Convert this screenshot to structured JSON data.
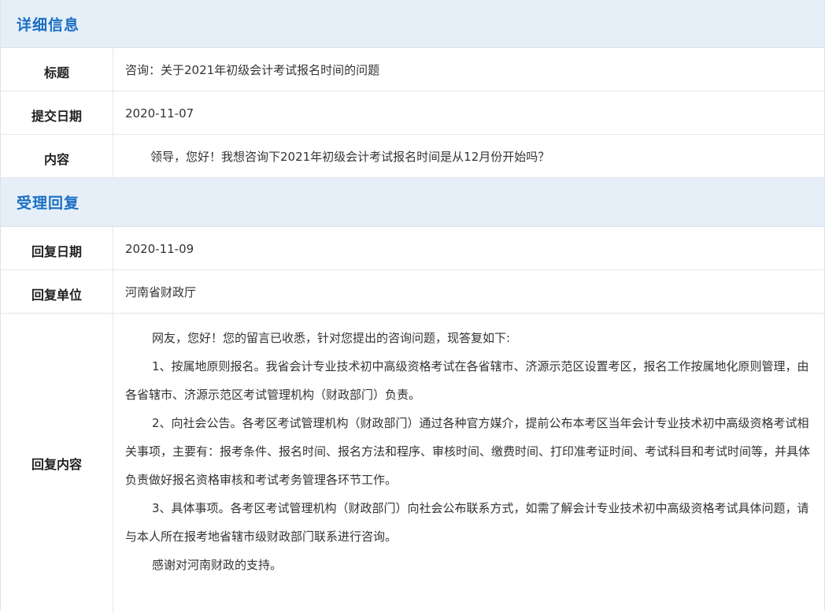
{
  "detail": {
    "header": "详细信息",
    "title_label": "标题",
    "title_value": "咨询：关于2021年初级会计考试报名时间的问题",
    "date_label": "提交日期",
    "date_value": "2020-11-07",
    "content_label": "内容",
    "content_value": "领导，您好！我想咨询下2021年初级会计考试报名时间是从12月份开始吗？"
  },
  "reply": {
    "header": "受理回复",
    "date_label": "回复日期",
    "date_value": "2020-11-09",
    "unit_label": "回复单位",
    "unit_value": "河南省财政厅",
    "content_label": "回复内容",
    "paragraphs": [
      "网友，您好！您的留言已收悉，针对您提出的咨询问题，现答复如下:",
      "1、按属地原则报名。我省会计专业技术初中高级资格考试在各省辖市、济源示范区设置考区，报名工作按属地化原则管理，由各省辖市、济源示范区考试管理机构（财政部门）负责。",
      "2、向社会公告。各考区考试管理机构（财政部门）通过各种官方媒介，提前公布本考区当年会计专业技术初中高级资格考试相关事项，主要有：报考条件、报名时间、报名方法和程序、审核时间、缴费时间、打印准考证时间、考试科目和考试时间等，并具体负责做好报名资格审核和考试考务管理各环节工作。",
      "3、具体事项。各考区考试管理机构（财政部门）向社会公布联系方式，如需了解会计专业技术初中高级资格考试具体问题，请与本人所在报考地省辖市级财政部门联系进行咨询。",
      "感谢对河南财政的支持。"
    ]
  }
}
